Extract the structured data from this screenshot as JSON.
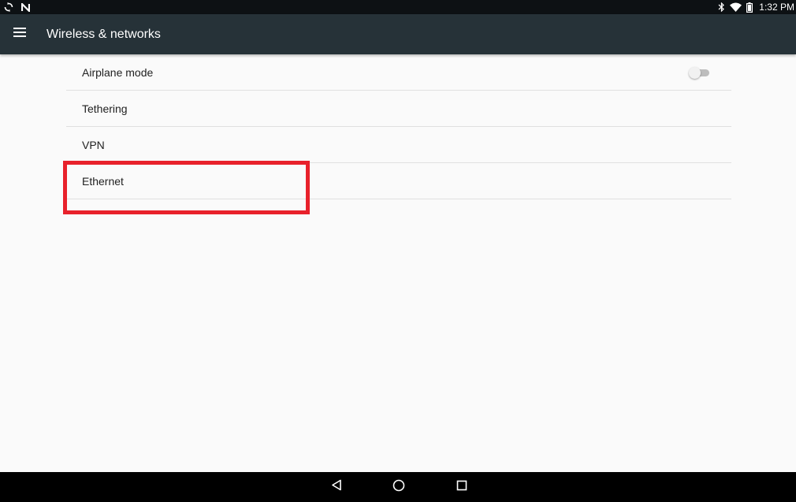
{
  "status_bar": {
    "time": "1:32 PM",
    "left_icons": [
      "sync-icon",
      "n-notification-icon"
    ],
    "right_icons": [
      "bluetooth-icon",
      "wifi-icon",
      "battery-icon"
    ]
  },
  "toolbar": {
    "title": "Wireless & networks",
    "menu_icon": "hamburger-menu-icon",
    "background": "#263238"
  },
  "preferences": [
    {
      "label": "Airplane mode",
      "toggle": "off"
    },
    {
      "label": "Tethering"
    },
    {
      "label": "VPN"
    },
    {
      "label": "Ethernet"
    }
  ],
  "highlight": {
    "target": "Ethernet",
    "color": "#e8212b"
  },
  "nav_bar": {
    "buttons": [
      "back-icon",
      "home-icon",
      "recents-icon"
    ]
  }
}
